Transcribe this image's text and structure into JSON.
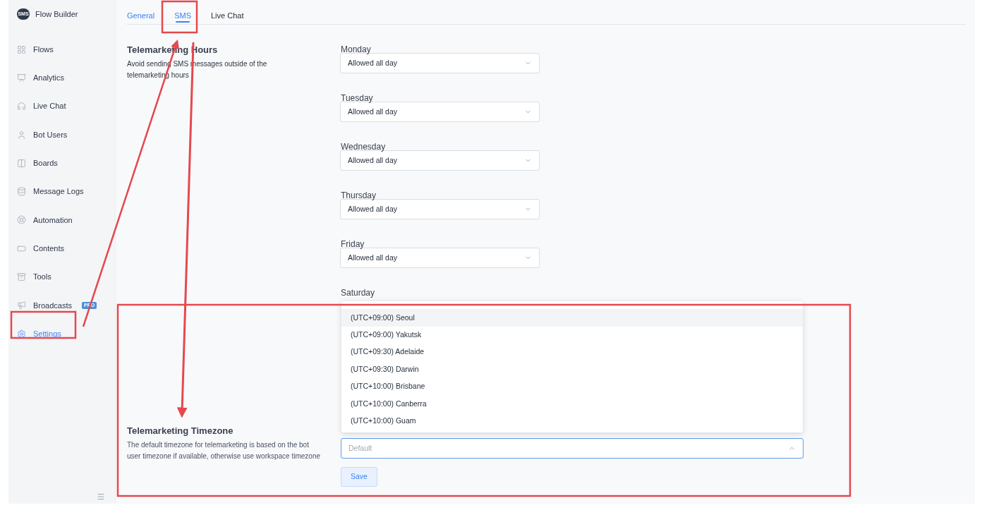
{
  "sidebar": {
    "brand": {
      "logo_text": "SMS",
      "name": "Flow Builder"
    },
    "items": [
      {
        "label": "Flows",
        "selected": false
      },
      {
        "label": "Analytics",
        "selected": false
      },
      {
        "label": "Live Chat",
        "selected": false
      },
      {
        "label": "Bot Users",
        "selected": false
      },
      {
        "label": "Boards",
        "selected": false
      },
      {
        "label": "Message Logs",
        "selected": false
      },
      {
        "label": "Automation",
        "selected": false
      },
      {
        "label": "Contents",
        "selected": false
      },
      {
        "label": "Tools",
        "selected": false
      },
      {
        "label": "Broadcasts",
        "badge": "PRO",
        "selected": false
      },
      {
        "label": "Settings",
        "selected": true
      }
    ]
  },
  "tabs": [
    {
      "label": "General",
      "selected": false
    },
    {
      "label": "SMS",
      "selected": true
    },
    {
      "label": "Live Chat",
      "selected": false
    }
  ],
  "hours": {
    "title": "Telemarketing Hours",
    "description": "Avoid sending SMS messages outside of the telemarketing hours",
    "days": [
      {
        "label": "Monday",
        "value": "Allowed all day"
      },
      {
        "label": "Tuesday",
        "value": "Allowed all day"
      },
      {
        "label": "Wednesday",
        "value": "Allowed all day"
      },
      {
        "label": "Thursday",
        "value": "Allowed all day"
      },
      {
        "label": "Friday",
        "value": "Allowed all day"
      },
      {
        "label": "Saturday"
      }
    ]
  },
  "timezone": {
    "title": "Telemarketing Timezone",
    "description": "The default timezone for telemarketing is based on the bot user timezone if available, otherwise use workspace timezone",
    "field": {
      "placeholder": "Default",
      "expanded": true
    },
    "options": [
      {
        "label": "(UTC+09:00) Seoul",
        "selected": true
      },
      {
        "label": "(UTC+09:00) Yakutsk",
        "selected": false
      },
      {
        "label": "(UTC+09:30) Adelaide",
        "selected": false
      },
      {
        "label": "(UTC+09:30) Darwin",
        "selected": false
      },
      {
        "label": "(UTC+10:00) Brisbane",
        "selected": false
      },
      {
        "label": "(UTC+10:00) Canberra",
        "selected": false
      },
      {
        "label": "(UTC+10:00) Guam",
        "selected": false
      }
    ],
    "save_button": "Save"
  }
}
